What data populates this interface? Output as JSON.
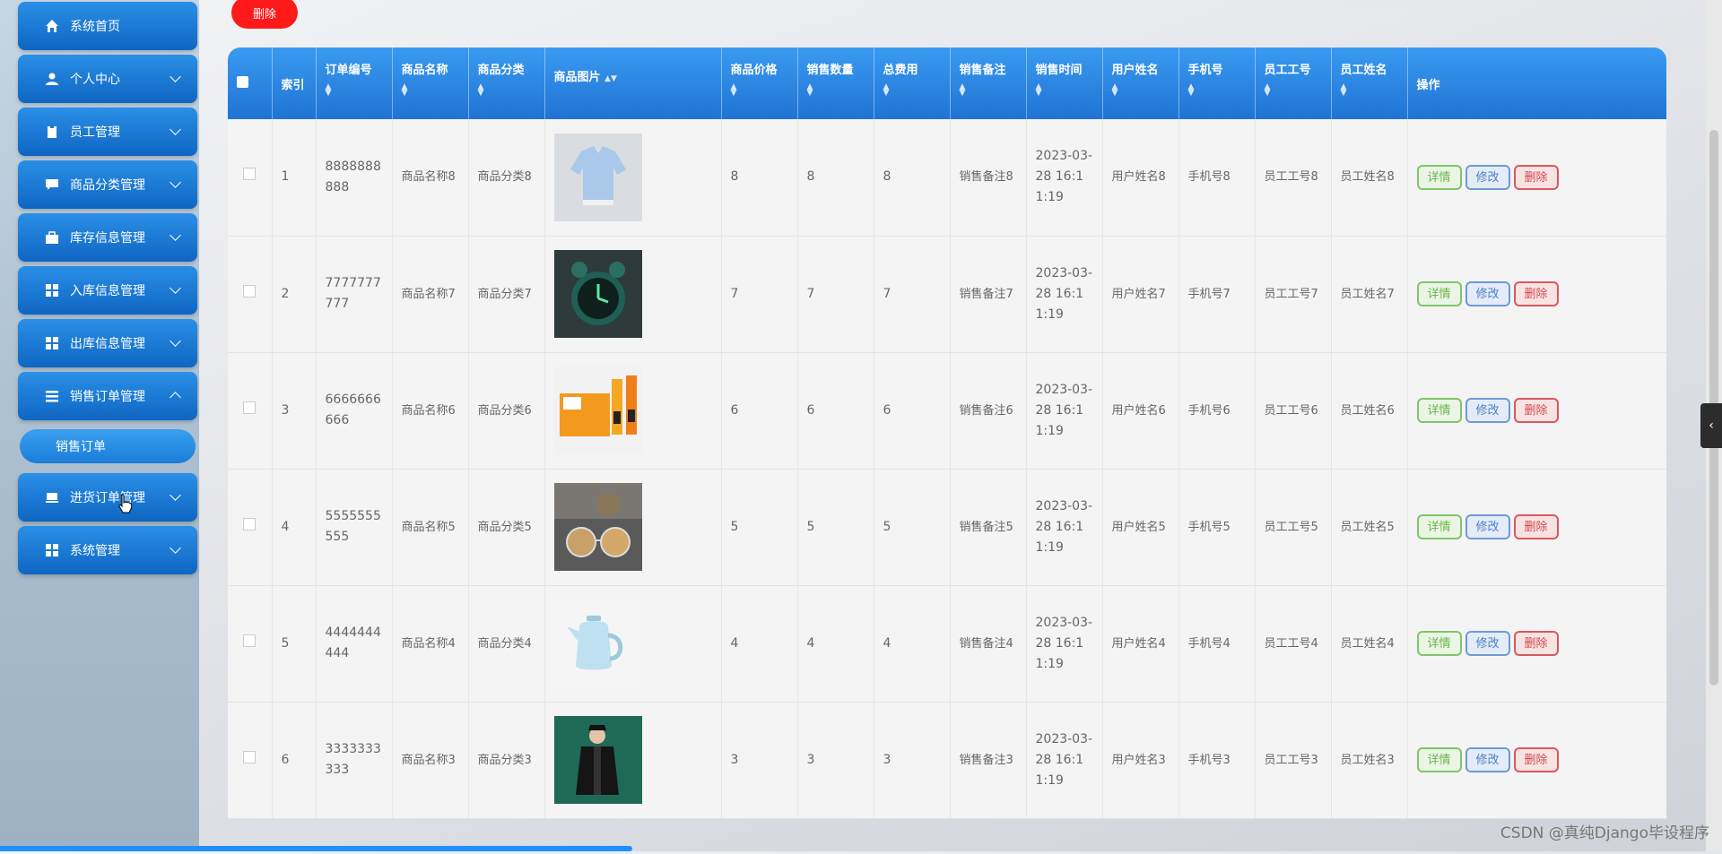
{
  "sidebar": {
    "items": [
      {
        "label": "系统首页",
        "icon": "home-icon",
        "has_arrow": false
      },
      {
        "label": "个人中心",
        "icon": "user-icon",
        "has_arrow": true
      },
      {
        "label": "员工管理",
        "icon": "clipboard-icon",
        "has_arrow": true
      },
      {
        "label": "商品分类管理",
        "icon": "chat-icon",
        "has_arrow": true
      },
      {
        "label": "库存信息管理",
        "icon": "briefcase-icon",
        "has_arrow": true
      },
      {
        "label": "入库信息管理",
        "icon": "grid-icon",
        "has_arrow": true
      },
      {
        "label": "出库信息管理",
        "icon": "grid-icon",
        "has_arrow": true
      },
      {
        "label": "销售订单管理",
        "icon": "list-icon",
        "has_arrow": true,
        "expanded": true
      },
      {
        "label": "进货订单管理",
        "icon": "drive-icon",
        "has_arrow": true
      },
      {
        "label": "系统管理",
        "icon": "grid-icon",
        "has_arrow": true
      }
    ],
    "sub_item": "销售订单"
  },
  "toolbar": {
    "delete_label": "删除"
  },
  "table": {
    "columns": [
      "索引",
      "订单编号",
      "商品名称",
      "商品分类",
      "商品图片",
      "商品价格",
      "销售数量",
      "总费用",
      "销售备注",
      "销售时间",
      "用户姓名",
      "手机号",
      "员工工号",
      "员工姓名",
      "操作"
    ],
    "actions": {
      "view": "详情",
      "edit": "修改",
      "delete": "删除"
    },
    "rows": [
      {
        "index": "1",
        "order_no": "8888888888",
        "name": "商品名称8",
        "category": "商品分类8",
        "image": "shirt",
        "price": "8",
        "qty": "8",
        "total": "8",
        "remark": "销售备注8",
        "time": "2023-03-28 16:11:19",
        "user": "用户姓名8",
        "phone": "手机号8",
        "emp_no": "员工工号8",
        "emp_name": "员工姓名8"
      },
      {
        "index": "2",
        "order_no": "7777777777",
        "name": "商品名称7",
        "category": "商品分类7",
        "image": "alarm-clock",
        "price": "7",
        "qty": "7",
        "total": "7",
        "remark": "销售备注7",
        "time": "2023-03-28 16:11:19",
        "user": "用户姓名7",
        "phone": "手机号7",
        "emp_no": "员工工号7",
        "emp_name": "员工姓名7"
      },
      {
        "index": "3",
        "order_no": "6666666666",
        "name": "商品名称6",
        "category": "商品分类6",
        "image": "juice-box",
        "price": "6",
        "qty": "6",
        "total": "6",
        "remark": "销售备注6",
        "time": "2023-03-28 16:11:19",
        "user": "用户姓名6",
        "phone": "手机号6",
        "emp_no": "员工工号6",
        "emp_name": "员工姓名6"
      },
      {
        "index": "4",
        "order_no": "5555555555",
        "name": "商品名称5",
        "category": "商品分类5",
        "image": "sunglasses",
        "price": "5",
        "qty": "5",
        "total": "5",
        "remark": "销售备注5",
        "time": "2023-03-28 16:11:19",
        "user": "用户姓名5",
        "phone": "手机号5",
        "emp_no": "员工工号5",
        "emp_name": "员工姓名5"
      },
      {
        "index": "5",
        "order_no": "4444444444",
        "name": "商品名称4",
        "category": "商品分类4",
        "image": "kettle",
        "price": "4",
        "qty": "4",
        "total": "4",
        "remark": "销售备注4",
        "time": "2023-03-28 16:11:19",
        "user": "用户姓名4",
        "phone": "手机号4",
        "emp_no": "员工工号4",
        "emp_name": "员工姓名4"
      },
      {
        "index": "6",
        "order_no": "3333333333",
        "name": "商品名称3",
        "category": "商品分类3",
        "image": "jacket",
        "price": "3",
        "qty": "3",
        "total": "3",
        "remark": "销售备注3",
        "time": "2023-03-28 16:11:19",
        "user": "用户姓名3",
        "phone": "手机号3",
        "emp_no": "员工工号3",
        "emp_name": "员工姓名3"
      }
    ]
  },
  "watermark": "CSDN @真纯Django毕设程序",
  "colors": {
    "nav_blue": "#1a78d6",
    "header_blue": "#2b86e4",
    "delete_red": "#ff1a1a"
  }
}
